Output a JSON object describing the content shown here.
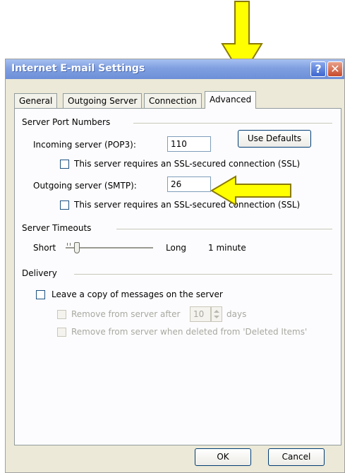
{
  "window": {
    "title": "Internet E-mail Settings",
    "help_glyph": "?",
    "close_glyph": "✕"
  },
  "tabs": [
    {
      "label": "General",
      "active": false
    },
    {
      "label": "Outgoing Server",
      "active": false
    },
    {
      "label": "Connection",
      "active": false
    },
    {
      "label": "Advanced",
      "active": true
    }
  ],
  "server_ports": {
    "group_label": "Server Port Numbers",
    "incoming_label": "Incoming server (POP3):",
    "incoming_value": "110",
    "use_defaults_label": "Use Defaults",
    "incoming_ssl_label": "This server requires an SSL-secured connection (SSL)",
    "incoming_ssl_checked": false,
    "outgoing_label": "Outgoing server (SMTP):",
    "outgoing_value": "26",
    "outgoing_ssl_label": "This server requires an SSL-secured connection (SSL)",
    "outgoing_ssl_checked": false
  },
  "server_timeouts": {
    "group_label": "Server Timeouts",
    "short_label": "Short",
    "long_label": "Long",
    "value_text": "1 minute",
    "slider_level": 0.1
  },
  "delivery": {
    "group_label": "Delivery",
    "leave_copy_label": "Leave a copy of messages on the server",
    "leave_copy_checked": false,
    "remove_after_label": "Remove from server after",
    "remove_after_days": "10",
    "days_label": "days",
    "remove_deleted_label": "Remove from server when deleted from 'Deleted Items'"
  },
  "footer": {
    "ok_label": "OK",
    "cancel_label": "Cancel"
  },
  "annotations": {
    "arrow_color": "#ffff00",
    "arrow_outline": "#8a7a00"
  },
  "colors": {
    "title_bar": "#7f9fe0",
    "dialog_face": "#ece9d8",
    "disabled_text": "#a8a8a0"
  }
}
